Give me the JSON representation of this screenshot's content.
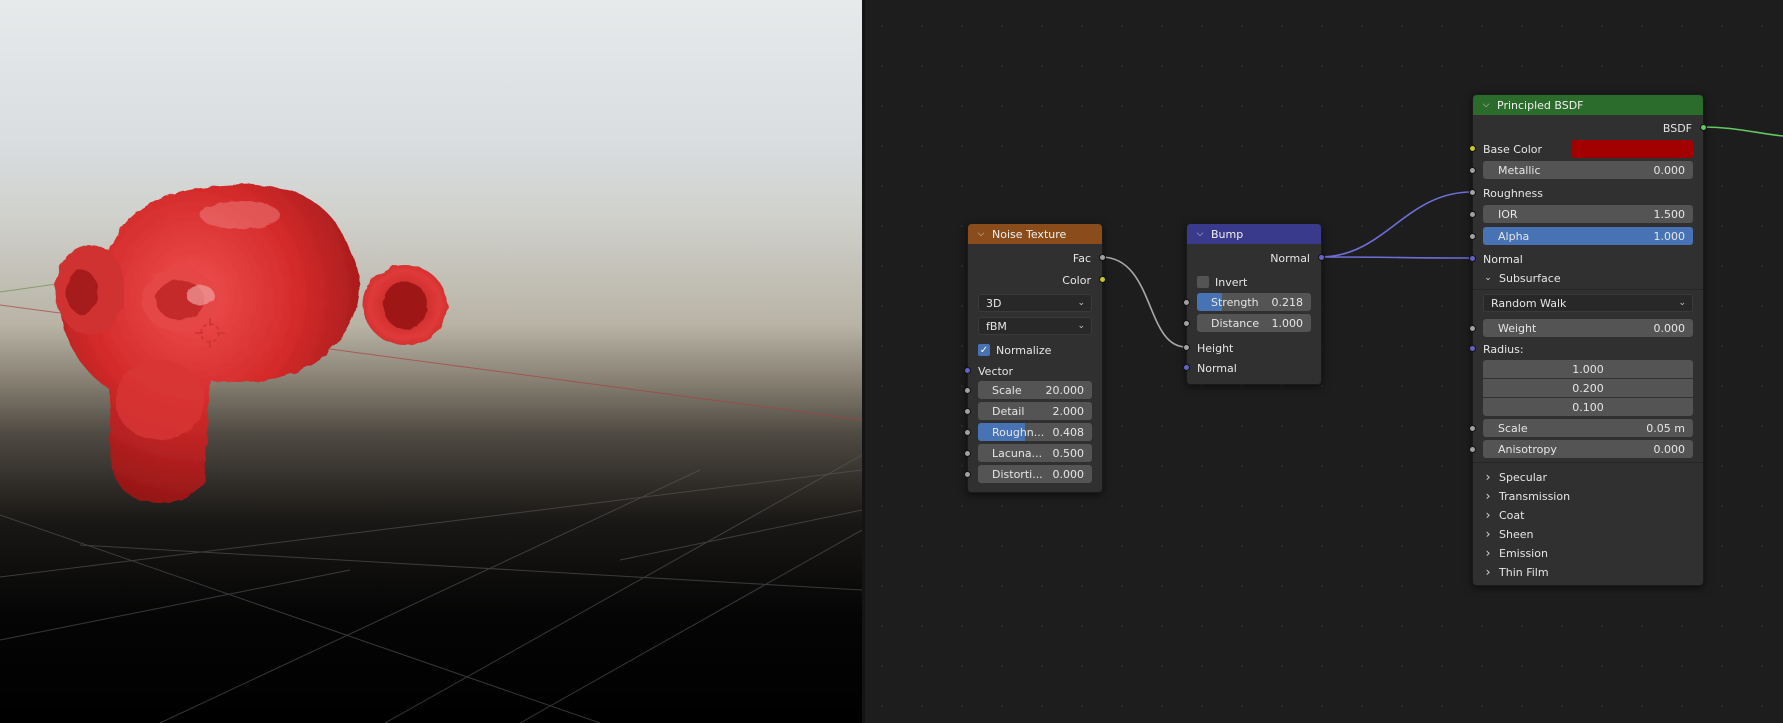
{
  "viewport": {
    "label": "3D viewport",
    "object": "Suzanne"
  },
  "noise_node": {
    "title": "Noise Texture",
    "color": "#8a4c1a",
    "outputs": [
      "Fac",
      "Color"
    ],
    "dimensions": "3D",
    "type": "fBM",
    "normalize_label": "Normalize",
    "vector_label": "Vector",
    "fields": [
      {
        "label": "Scale",
        "value": "20.000"
      },
      {
        "label": "Detail",
        "value": "2.000"
      },
      {
        "label": "Roughn...",
        "value": "0.408",
        "fraction": 0.408
      },
      {
        "label": "Lacuna...",
        "value": "0.500"
      },
      {
        "label": "Distorti...",
        "value": "0.000"
      }
    ]
  },
  "bump_node": {
    "title": "Bump",
    "color": "#3a3a8c",
    "output": "Normal",
    "invert_label": "Invert",
    "strength": {
      "label": "Strength",
      "value": "0.218",
      "fraction": 0.218
    },
    "distance": {
      "label": "Distance",
      "value": "1.000"
    },
    "height_label": "Height",
    "normal_label": "Normal"
  },
  "bsdf_node": {
    "title": "Principled BSDF",
    "color": "#2b6b2b",
    "output": "BSDF",
    "base_color_label": "Base Color",
    "base_color_value": "#a30000",
    "metallic": {
      "label": "Metallic",
      "value": "0.000"
    },
    "roughness_label": "Roughness",
    "ior": {
      "label": "IOR",
      "value": "1.500"
    },
    "alpha": {
      "label": "Alpha",
      "value": "1.000",
      "fraction": 1.0
    },
    "normal_label": "Normal",
    "subsurface_label": "Subsurface",
    "subsurface_method": "Random Walk",
    "weight": {
      "label": "Weight",
      "value": "0.000"
    },
    "radius_label": "Radius:",
    "radius": [
      "1.000",
      "0.200",
      "0.100"
    ],
    "scale": {
      "label": "Scale",
      "value": "0.05 m"
    },
    "anisotropy": {
      "label": "Anisotropy",
      "value": "0.000"
    },
    "panels": [
      "Specular",
      "Transmission",
      "Coat",
      "Sheen",
      "Emission",
      "Thin Film"
    ]
  }
}
